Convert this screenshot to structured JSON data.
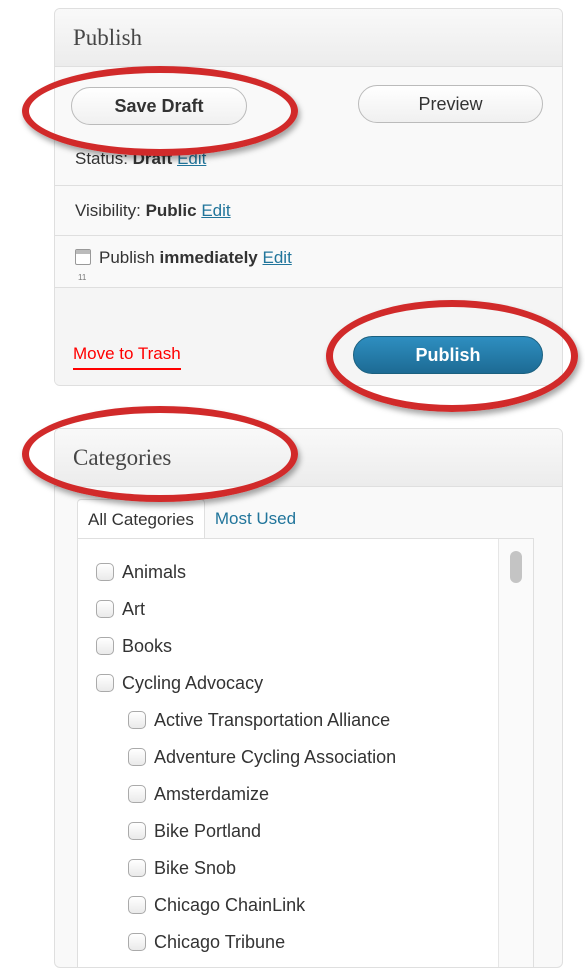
{
  "publish": {
    "title": "Publish",
    "save_draft": "Save Draft",
    "preview": "Preview",
    "status_label": "Status:",
    "status_value": "Draft",
    "visibility_label": "Visibility:",
    "visibility_value": "Public",
    "publish_label": "Publish",
    "publish_value": "immediately",
    "edit": "Edit",
    "trash": "Move to Trash",
    "publish_button": "Publish"
  },
  "categories": {
    "title": "Categories",
    "tabs": [
      "All Categories",
      "Most Used"
    ],
    "items": [
      {
        "label": "Animals",
        "level": 0
      },
      {
        "label": "Art",
        "level": 0
      },
      {
        "label": "Books",
        "level": 0
      },
      {
        "label": "Cycling Advocacy",
        "level": 0
      },
      {
        "label": "Active Transportation Alliance",
        "level": 1
      },
      {
        "label": "Adventure Cycling Association",
        "level": 1
      },
      {
        "label": "Amsterdamize",
        "level": 1
      },
      {
        "label": "Bike Portland",
        "level": 1
      },
      {
        "label": "Bike Snob",
        "level": 1
      },
      {
        "label": "Chicago ChainLink",
        "level": 1
      },
      {
        "label": "Chicago Tribune",
        "level": 1
      }
    ]
  },
  "colors": {
    "annotation": "#d12a2a",
    "link": "#21759b",
    "trash": "#ff0000",
    "primary_button": "#21759b"
  }
}
